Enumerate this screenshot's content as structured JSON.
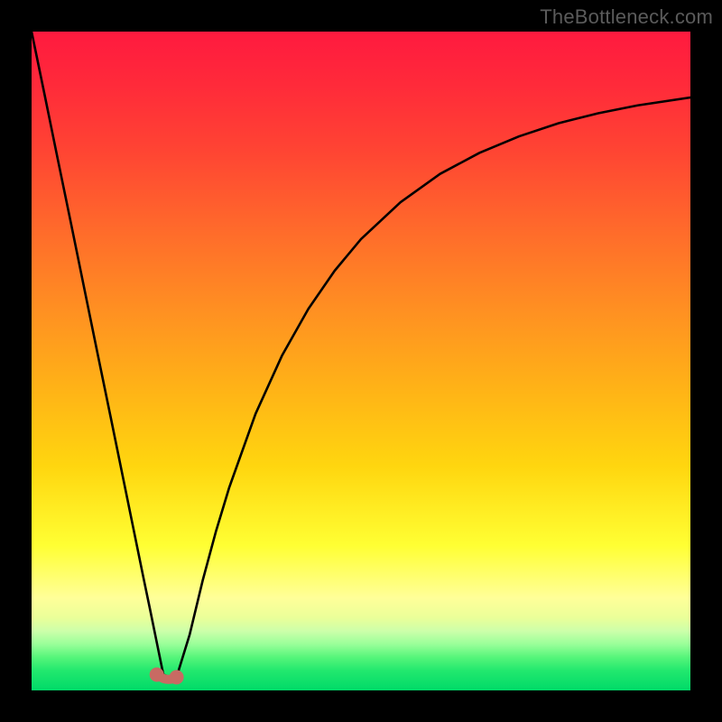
{
  "attribution": "TheBottleneck.com",
  "colors": {
    "frame": "#000000",
    "gradient_top": "#ff1a3f",
    "gradient_bottom": "#00da68",
    "curve": "#000000",
    "markers": "#c86a63"
  },
  "chart_data": {
    "type": "line",
    "title": "",
    "xlabel": "",
    "ylabel": "",
    "xlim": [
      0,
      100
    ],
    "ylim": [
      0,
      100
    ],
    "x": [
      0,
      2,
      4,
      6,
      8,
      10,
      12,
      14,
      16,
      17,
      18,
      19,
      20,
      21,
      22,
      24,
      26,
      28,
      30,
      34,
      38,
      42,
      46,
      50,
      56,
      62,
      68,
      74,
      80,
      86,
      92,
      100
    ],
    "values": [
      100,
      90.3,
      80.5,
      70.8,
      61.0,
      51.2,
      41.5,
      31.7,
      21.9,
      17.0,
      12.2,
      7.3,
      2.4,
      2.0,
      2.0,
      8.5,
      16.8,
      24.2,
      30.8,
      42.0,
      50.8,
      57.9,
      63.7,
      68.5,
      74.1,
      78.4,
      81.6,
      84.1,
      86.1,
      87.6,
      88.8,
      90.0
    ],
    "markers": [
      {
        "x": 19,
        "y": 2.4
      },
      {
        "x": 22,
        "y": 2.0
      }
    ],
    "grid": false,
    "legend": false
  }
}
